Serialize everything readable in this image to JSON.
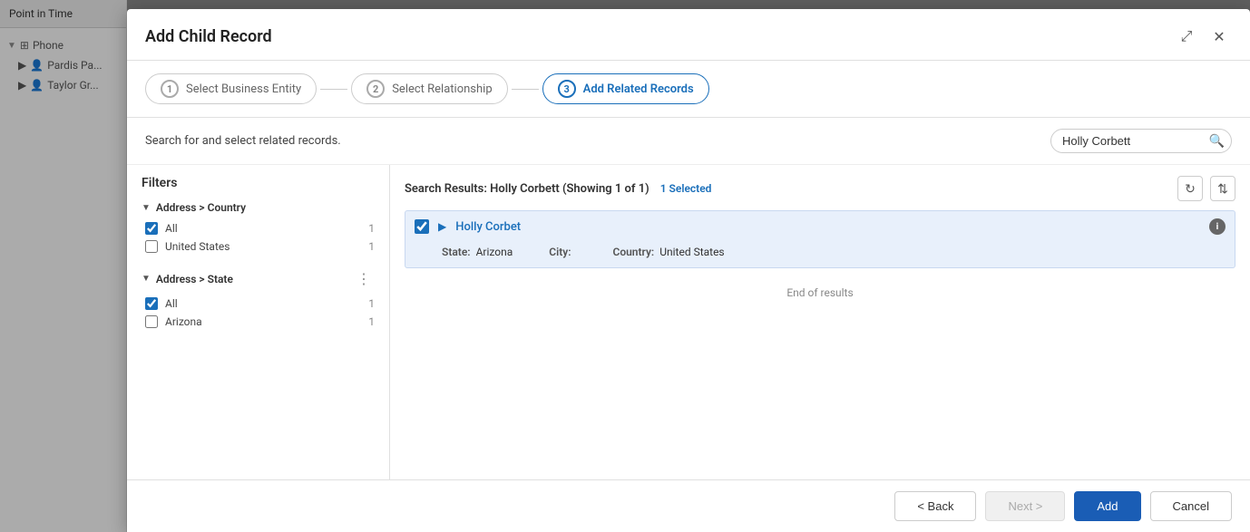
{
  "sidebar": {
    "header": "Point in Time",
    "tree": [
      {
        "label": "Phone",
        "type": "folder",
        "indent": 0
      },
      {
        "label": "Pardis Pa...",
        "type": "person",
        "indent": 1
      },
      {
        "label": "Taylor Gr...",
        "type": "person",
        "indent": 1
      }
    ]
  },
  "modal": {
    "title": "Add Child Record",
    "expand_icon": "⤢",
    "close_icon": "✕",
    "stepper": {
      "steps": [
        {
          "number": "1",
          "label": "Select Business Entity",
          "state": "inactive"
        },
        {
          "number": "2",
          "label": "Select Relationship",
          "state": "inactive"
        },
        {
          "number": "3",
          "label": "Add Related Records",
          "state": "active"
        }
      ]
    },
    "search": {
      "description": "Search for and select related records.",
      "placeholder": "Holly Corbett",
      "value": "Holly Corbett"
    },
    "filters": {
      "title": "Filters",
      "groups": [
        {
          "label": "Address > Country",
          "options": [
            {
              "label": "All",
              "count": "1",
              "checked": true
            },
            {
              "label": "United States",
              "count": "1",
              "checked": false
            }
          ]
        },
        {
          "label": "Address > State",
          "options": [
            {
              "label": "All",
              "count": "1",
              "checked": true
            },
            {
              "label": "Arizona",
              "count": "1",
              "checked": false
            }
          ]
        }
      ]
    },
    "results": {
      "title": "Search Results: Holly Corbett (Showing 1 of 1)",
      "selected_text": "1 Selected",
      "refresh_icon": "↻",
      "sort_icon": "⇅",
      "items": [
        {
          "name": "Holly Corbet",
          "checked": true,
          "state_label": "State:",
          "state_value": "Arizona",
          "city_label": "City:",
          "city_value": "",
          "country_label": "Country:",
          "country_value": "United States"
        }
      ],
      "end_of_results": "End of results"
    },
    "footer": {
      "back_label": "< Back",
      "next_label": "Next >",
      "add_label": "Add",
      "cancel_label": "Cancel"
    }
  }
}
